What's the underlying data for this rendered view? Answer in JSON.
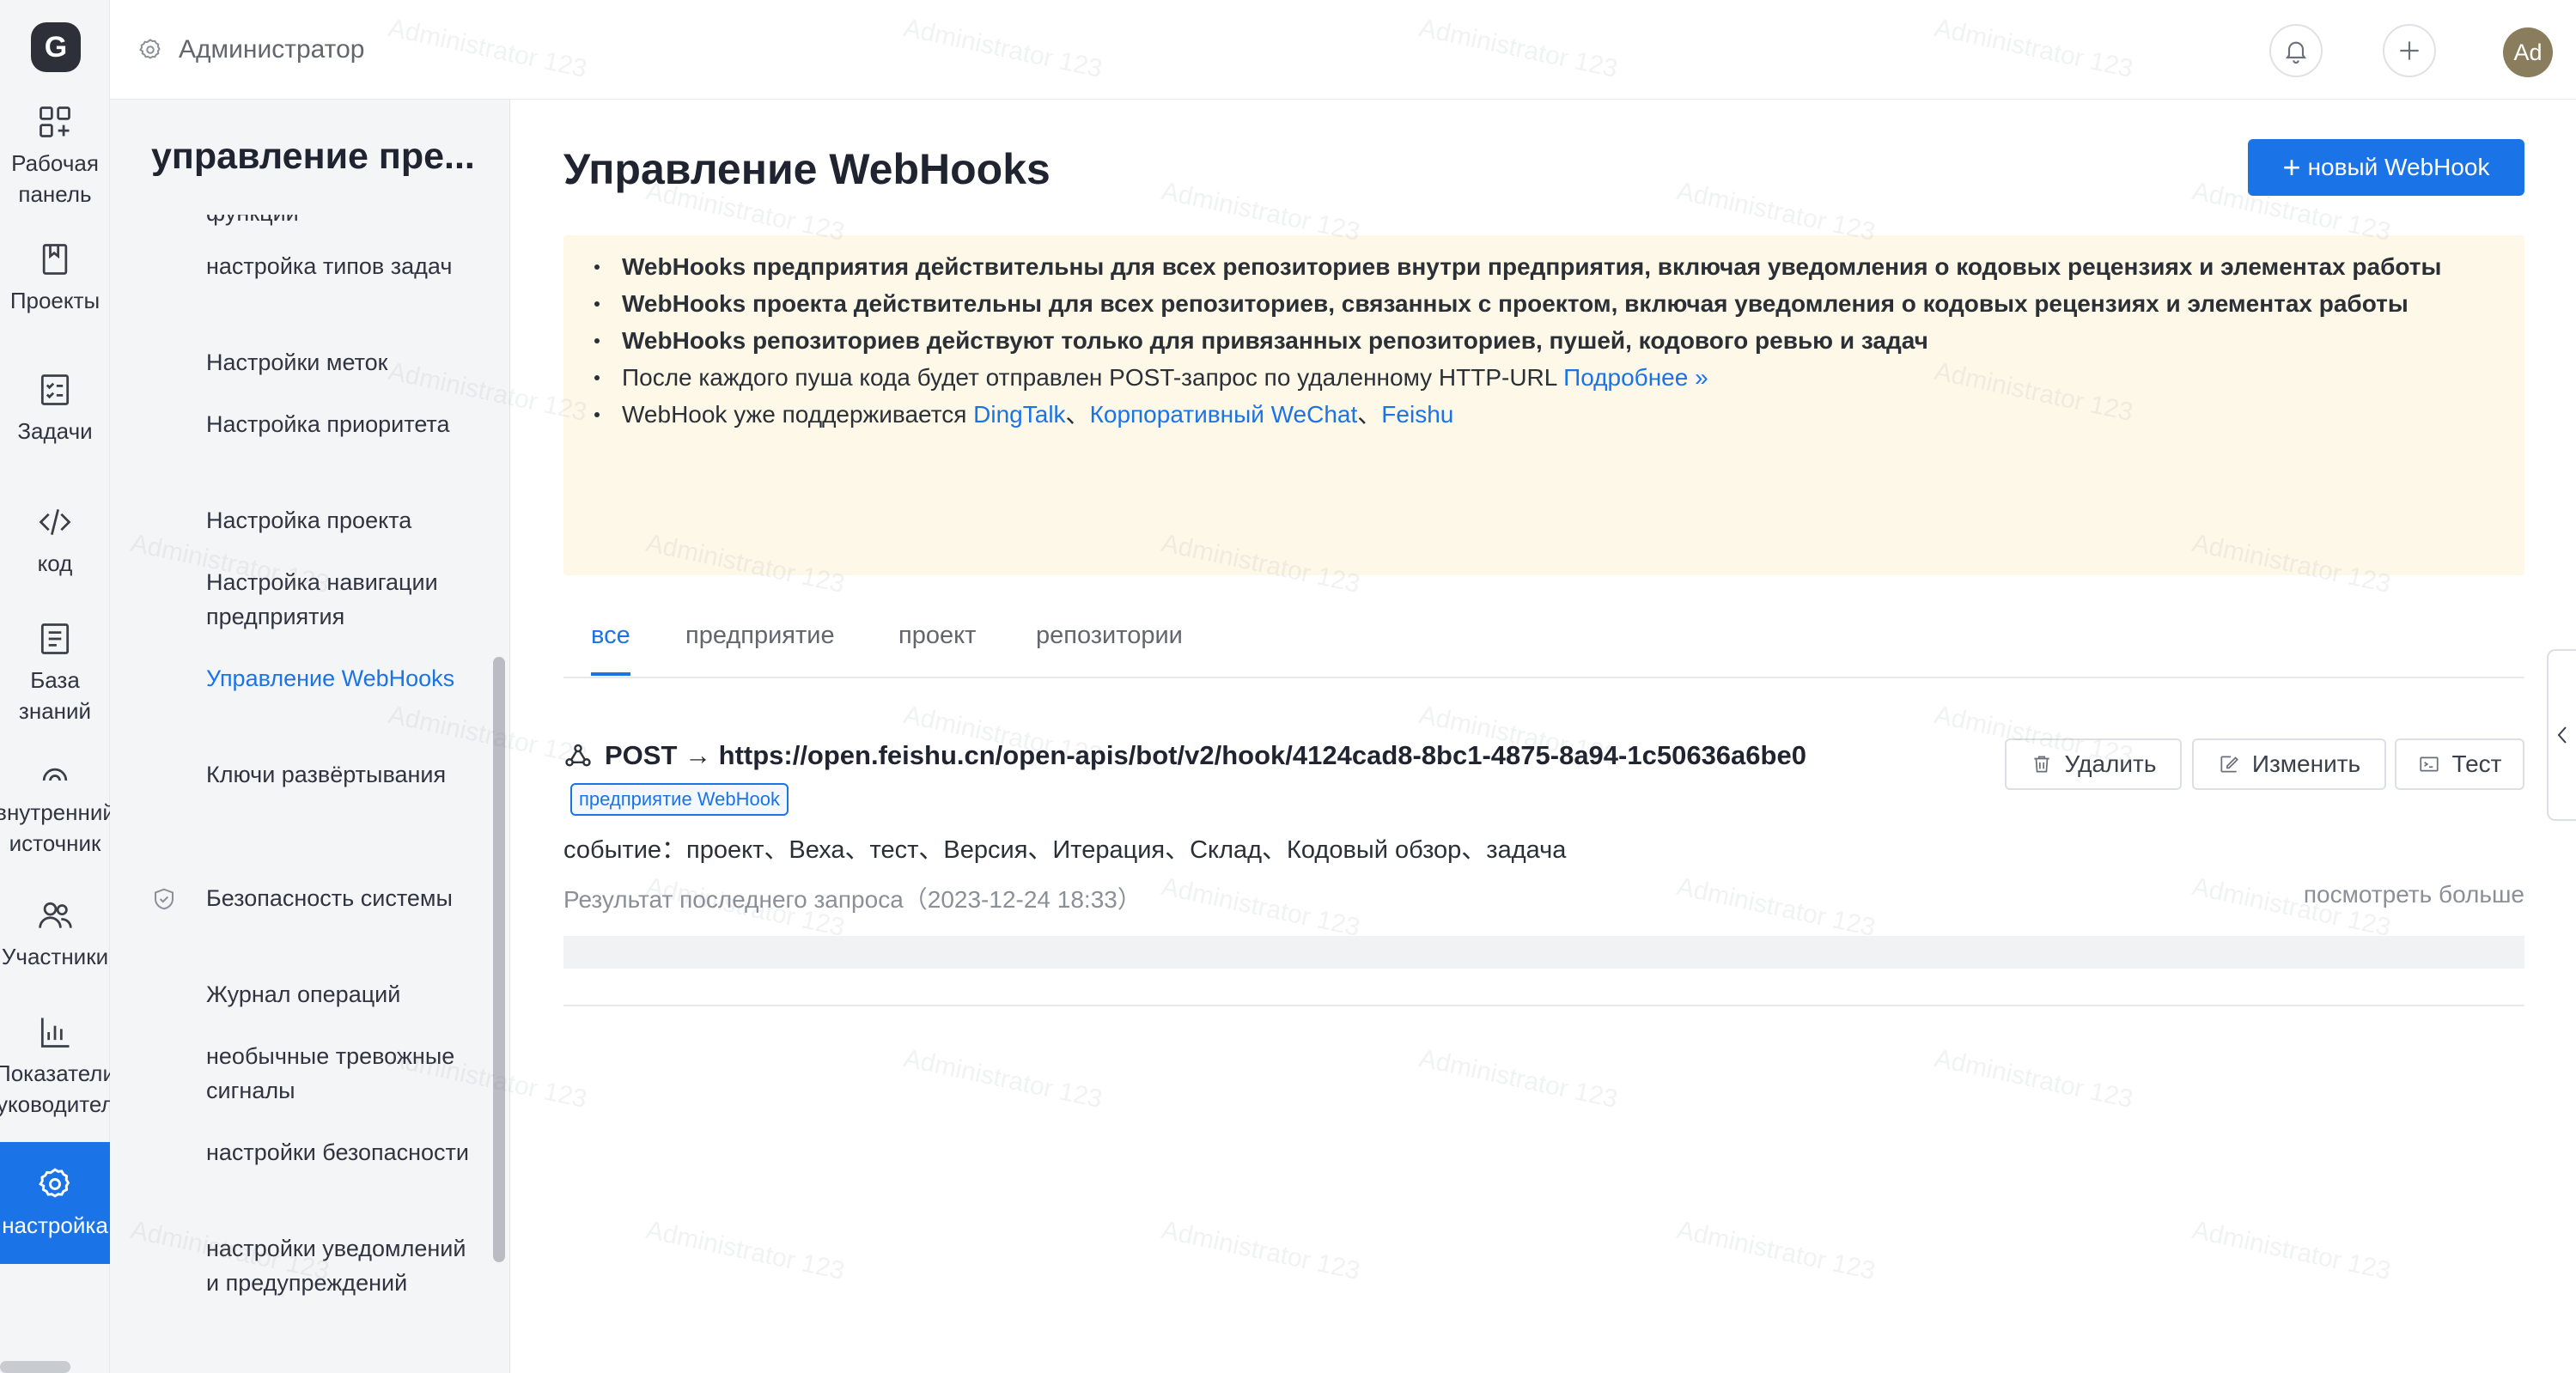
{
  "rail": {
    "logo": "G",
    "items": [
      {
        "label": "Рабочая\nпанель",
        "icon": "dashboard-icon"
      },
      {
        "label": "Проекты",
        "icon": "book-icon"
      },
      {
        "label": "Задачи",
        "icon": "checklist-icon"
      },
      {
        "label": "код",
        "icon": "code-icon"
      },
      {
        "label": "База\nзнаний",
        "icon": "document-icon"
      },
      {
        "label": "внутренний\nисточник",
        "icon": "source-icon"
      },
      {
        "label": "Участники",
        "icon": "users-icon"
      },
      {
        "label": "Показатели\nруководитель",
        "icon": "bar-chart-icon"
      },
      {
        "label": "настройка",
        "icon": "gear-icon"
      }
    ]
  },
  "sidebar": {
    "breadcrumb": "Администратор",
    "title": "управление пре...",
    "cut_item": "функции",
    "items": [
      {
        "label": "настройка типов задач"
      },
      {
        "label": "Настройки меток"
      },
      {
        "label": "Настройка приоритета"
      },
      {
        "label": "Настройка проекта"
      },
      {
        "label": "Настройка навигации предприятия"
      },
      {
        "label": "Управление WebHooks",
        "active": true
      },
      {
        "label": "Ключи развёртывания"
      },
      {
        "label": "Безопасность системы",
        "group": true
      },
      {
        "label": "Журнал операций"
      },
      {
        "label": "необычные тревожные сигналы"
      },
      {
        "label": "настройки безопасности"
      },
      {
        "label": "настройки уведомлений и предупреждений"
      }
    ]
  },
  "topbar": {
    "avatar": "Ad"
  },
  "main": {
    "title": "Управление WebHooks",
    "new_button": "новый WebHook",
    "notice": {
      "line1": "WebHooks предприятия действительны для всех репозиториев внутри предприятия, включая уведомления о кодовых рецензиях и элементах работы",
      "line2": "WebHooks проекта действительны для всех репозиториев, связанных с проектом, включая уведомления о кодовых рецензиях и элементах работы",
      "line3": "WebHooks репозиториев действуют только для привязанных репозиториев, пушей, кодового ревью и задач",
      "line4_text": "После каждого пуша кода будет отправлен POST-запрос по удаленному HTTP-URL ",
      "line4_link": "Подробнее »",
      "line5_text": "WebHook уже поддерживается ",
      "line5_link1": "DingTalk",
      "line5_sep1": "、",
      "line5_link2": "Корпоративный WeChat",
      "line5_sep2": "、",
      "line5_link3": "Feishu"
    },
    "tabs": [
      "все",
      "предприятие",
      "проект",
      "репозитории"
    ],
    "active_tab": 0,
    "webhook": {
      "method_url": "POST → https://open.feishu.cn/open-apis/bot/v2/hook/4124cad8-8bc1-4875-8a94-1c50636a6be0",
      "badge": "предприятие WebHook",
      "events": "событие：проект、Веха、тест、Версия、Итерация、Склад、Кодовый обзор、задача",
      "last_request": "Результат последнего запроса（2023-12-24 18:33）",
      "see_more": "посмотреть больше",
      "actions": {
        "delete": "Удалить",
        "edit": "Изменить",
        "test": "Тест"
      }
    },
    "watermark": "Administrator 123"
  },
  "colors": {
    "accent": "#1b73e8",
    "notice_bg": "#fdf8e8",
    "sidebar_bg": "#f4f5f7"
  }
}
